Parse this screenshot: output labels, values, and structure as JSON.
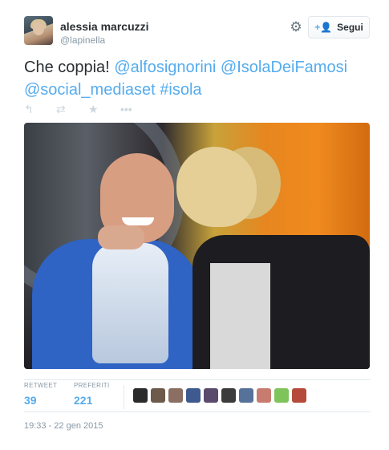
{
  "user": {
    "name": "alessia marcuzzi",
    "handle": "@lapinella"
  },
  "header": {
    "follow_label": "Segui",
    "follow_icon": "person-add-icon",
    "settings_icon": "gear-icon"
  },
  "tweet": {
    "text_plain": "Che coppia!",
    "mention1": "@alfosignorini",
    "mention2": "@IsolaDeiFamosi",
    "mention3": "@social_mediaset",
    "hashtag": "#isola"
  },
  "actions": [
    {
      "icon": "reply-icon",
      "glyph": "↰"
    },
    {
      "icon": "retweet-icon",
      "glyph": "⇄"
    },
    {
      "icon": "favorite-star-icon",
      "glyph": "★"
    },
    {
      "icon": "more-icon",
      "glyph": "•••"
    }
  ],
  "stats": {
    "retweet_label": "RETWEET",
    "retweet_count": "39",
    "favorites_label": "PREFERITI",
    "favorites_count": "221"
  },
  "favoriter_colors": [
    "#2b2b2b",
    "#6d5a4b",
    "#8a6f62",
    "#3e5a8f",
    "#5a4a6b",
    "#3b3b3b",
    "#56729a",
    "#c87c6f",
    "#7ec45b",
    "#b54a3a"
  ],
  "timestamp": "19:33 - 22 gen 2015",
  "colors": {
    "link": "#55acee",
    "text": "#292f33",
    "muted": "#8899a6"
  }
}
